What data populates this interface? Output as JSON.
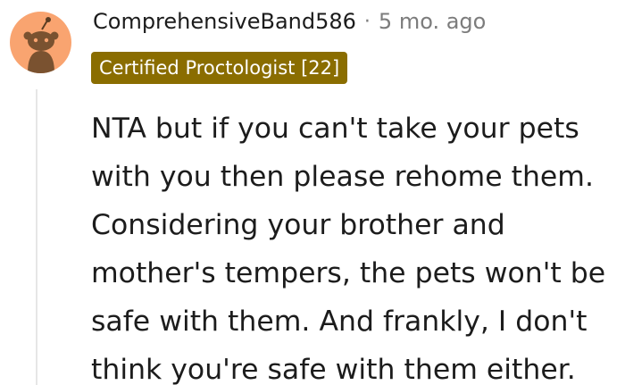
{
  "comment": {
    "avatar_icon": "reddit-snoo-avatar-icon",
    "avatar_bg": "#f9a470",
    "username": "ComprehensiveBand586",
    "separator": "·",
    "timestamp": "5 mo. ago",
    "flair": {
      "text": "Certified Proctologist [22]",
      "bg_color": "#8a6d00",
      "text_color": "#ffffff"
    },
    "body_lines": [
      "NTA but if you can't take your pets",
      "with you then please rehome them.",
      "Considering your brother and",
      "mother's tempers, the pets won't be",
      "safe with them. And frankly, I don't",
      "think you're safe with them either."
    ]
  }
}
